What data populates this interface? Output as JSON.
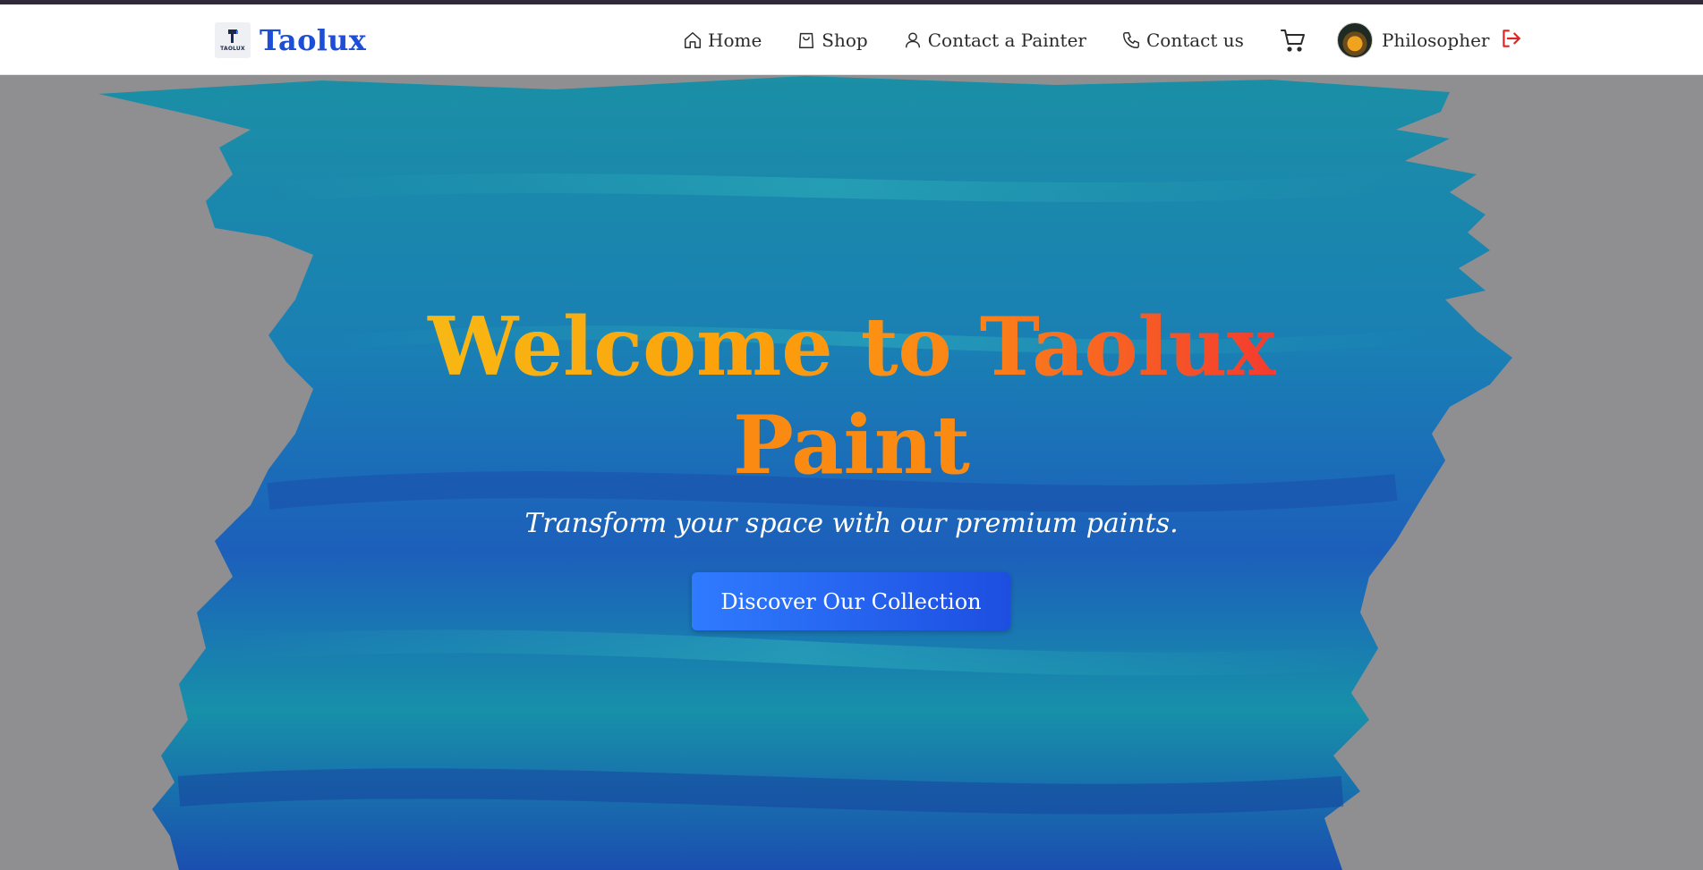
{
  "header": {
    "brand": {
      "name": "Taolux",
      "logo_text": "TAOLUX",
      "logo_icon": "paint-bucket-icon"
    },
    "nav": [
      {
        "label": "Home",
        "icon": "home-icon"
      },
      {
        "label": "Shop",
        "icon": "shopping-bag-icon"
      },
      {
        "label": "Contact a Painter",
        "icon": "user-icon"
      },
      {
        "label": "Contact us",
        "icon": "phone-icon"
      }
    ],
    "cart_icon": "cart-icon",
    "user": {
      "name": "Philosopher",
      "logout_icon": "logout-icon"
    }
  },
  "hero": {
    "title_line1": "Welcome to Taolux",
    "title_line2": "Paint",
    "subtitle": "Transform your space with our premium paints.",
    "cta_label": "Discover Our Collection"
  },
  "colors": {
    "brand": "#1d4ed8",
    "title_gradient_start": "#f8b814",
    "title_gradient_end": "#f33b2f",
    "cta_start": "#2f7bff",
    "cta_end": "#1d4ee0",
    "logout": "#dc2626",
    "paint_teal": "#1590a8",
    "paint_blue": "#1a4fb0",
    "backdrop_gray": "#8f8f92"
  }
}
